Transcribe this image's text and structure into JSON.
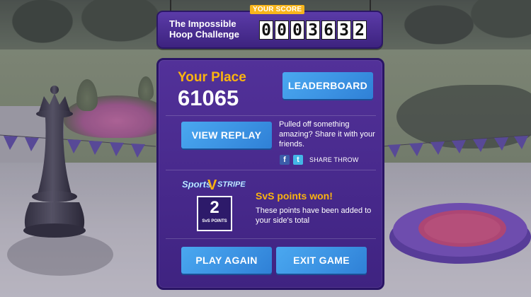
{
  "banner": {
    "title": "The Impossible Hoop Challenge",
    "score_label": "YOUR SCORE",
    "score_digits": [
      "0",
      "0",
      "0",
      "3",
      "6",
      "3",
      "2"
    ]
  },
  "results": {
    "place_label": "Your Place",
    "place_value": "61065",
    "leaderboard_label": "LEADERBOARD",
    "replay_label": "VIEW REPLAY",
    "share_text": "Pulled off something amazing? Share it with your friends.",
    "share_throw_label": "SHARE THROW",
    "svs": {
      "logo_text_left": "Sports",
      "logo_text_right": "STRIPES",
      "points_value": "2",
      "points_unit": "SvS POINTS",
      "won_label": "SvS points won!",
      "description": "These points have been added to your side's total"
    },
    "play_again_label": "PLAY AGAIN",
    "exit_label": "EXIT GAME"
  },
  "icons": {
    "facebook": "facebook-icon",
    "twitter": "twitter-icon"
  },
  "colors": {
    "panel": "#4a2c90",
    "accent_yellow": "#fbb40f",
    "button_blue": "#3c93e3"
  }
}
